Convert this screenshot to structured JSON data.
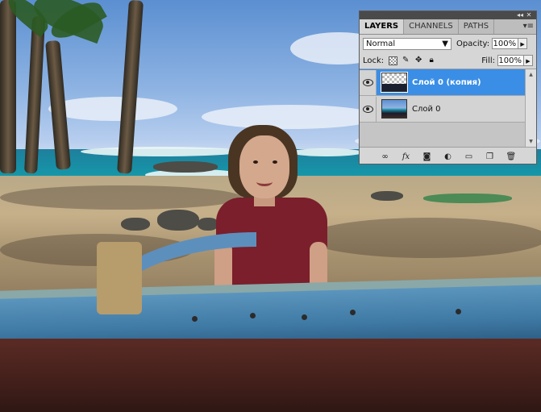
{
  "panel": {
    "tabs": [
      {
        "label": "LAYERS",
        "active": true
      },
      {
        "label": "CHANNELS",
        "active": false
      },
      {
        "label": "PATHS",
        "active": false
      }
    ],
    "menu_icon": "panel-menu-icon",
    "collapse_icon": "collapse-icon",
    "close_icon": "close-icon",
    "blend_mode": "Normal",
    "opacity_label": "Opacity:",
    "opacity_value": "100%",
    "lock_label": "Lock:",
    "fill_label": "Fill:",
    "fill_value": "100%",
    "layers": [
      {
        "name": "Слой 0 (копия)",
        "selected": true,
        "visible": true
      },
      {
        "name": "Слой 0",
        "selected": false,
        "visible": true
      }
    ],
    "bottom_icons": [
      "link-layers-icon",
      "fx-icon",
      "add-mask-icon",
      "adjustment-layer-icon",
      "new-group-icon",
      "new-layer-icon",
      "trash-icon"
    ],
    "fx_label": "fx",
    "accent_color": "#3a8ee6"
  }
}
